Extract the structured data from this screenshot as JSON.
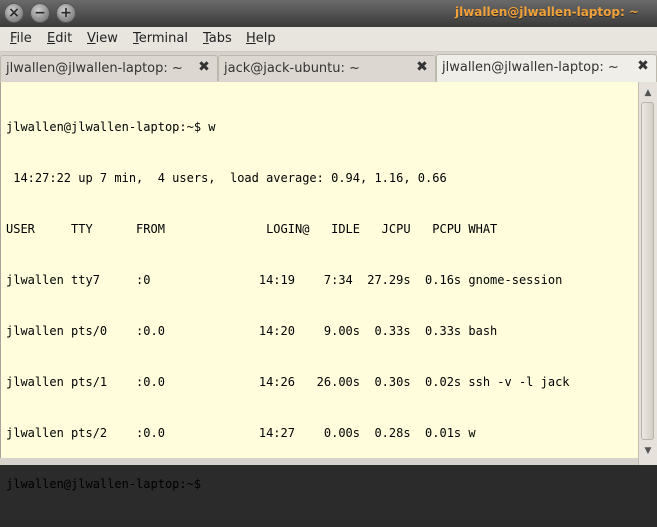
{
  "window": {
    "title": "jlwallen@jlwallen-laptop: ~",
    "controls": {
      "close": "×",
      "minimize": "−",
      "maximize": "+"
    }
  },
  "menubar": {
    "items": [
      {
        "label": "File",
        "mnemonic": "F",
        "rest": "ile"
      },
      {
        "label": "Edit",
        "mnemonic": "E",
        "rest": "dit"
      },
      {
        "label": "View",
        "mnemonic": "V",
        "rest": "iew"
      },
      {
        "label": "Terminal",
        "mnemonic": "T",
        "rest": "erminal"
      },
      {
        "label": "Tabs",
        "mnemonic": "T",
        "rest": "abs"
      },
      {
        "label": "Help",
        "mnemonic": "H",
        "rest": "elp"
      }
    ]
  },
  "tabs": [
    {
      "label": "jlwallen@jlwallen-laptop: ~",
      "close": "✖",
      "active": false
    },
    {
      "label": "jack@jack-ubuntu: ~",
      "close": "✖",
      "active": false
    },
    {
      "label": "jlwallen@jlwallen-laptop: ~",
      "close": "✖",
      "active": true
    }
  ],
  "terminal": {
    "lines": [
      "jlwallen@jlwallen-laptop:~$ w",
      " 14:27:22 up 7 min,  4 users,  load average: 0.94, 1.16, 0.66",
      "USER     TTY      FROM              LOGIN@   IDLE   JCPU   PCPU WHAT",
      "jlwallen tty7     :0               14:19    7:34  27.29s  0.16s gnome-session",
      "jlwallen pts/0    :0.0             14:20    9.00s  0.33s  0.33s bash",
      "jlwallen pts/1    :0.0             14:26   26.00s  0.30s  0.02s ssh -v -l jack",
      "jlwallen pts/2    :0.0             14:27    0.00s  0.28s  0.01s w",
      "jlwallen@jlwallen-laptop:~$"
    ]
  },
  "scrollbar": {
    "up_arrow": "▲",
    "down_arrow": "▼"
  }
}
